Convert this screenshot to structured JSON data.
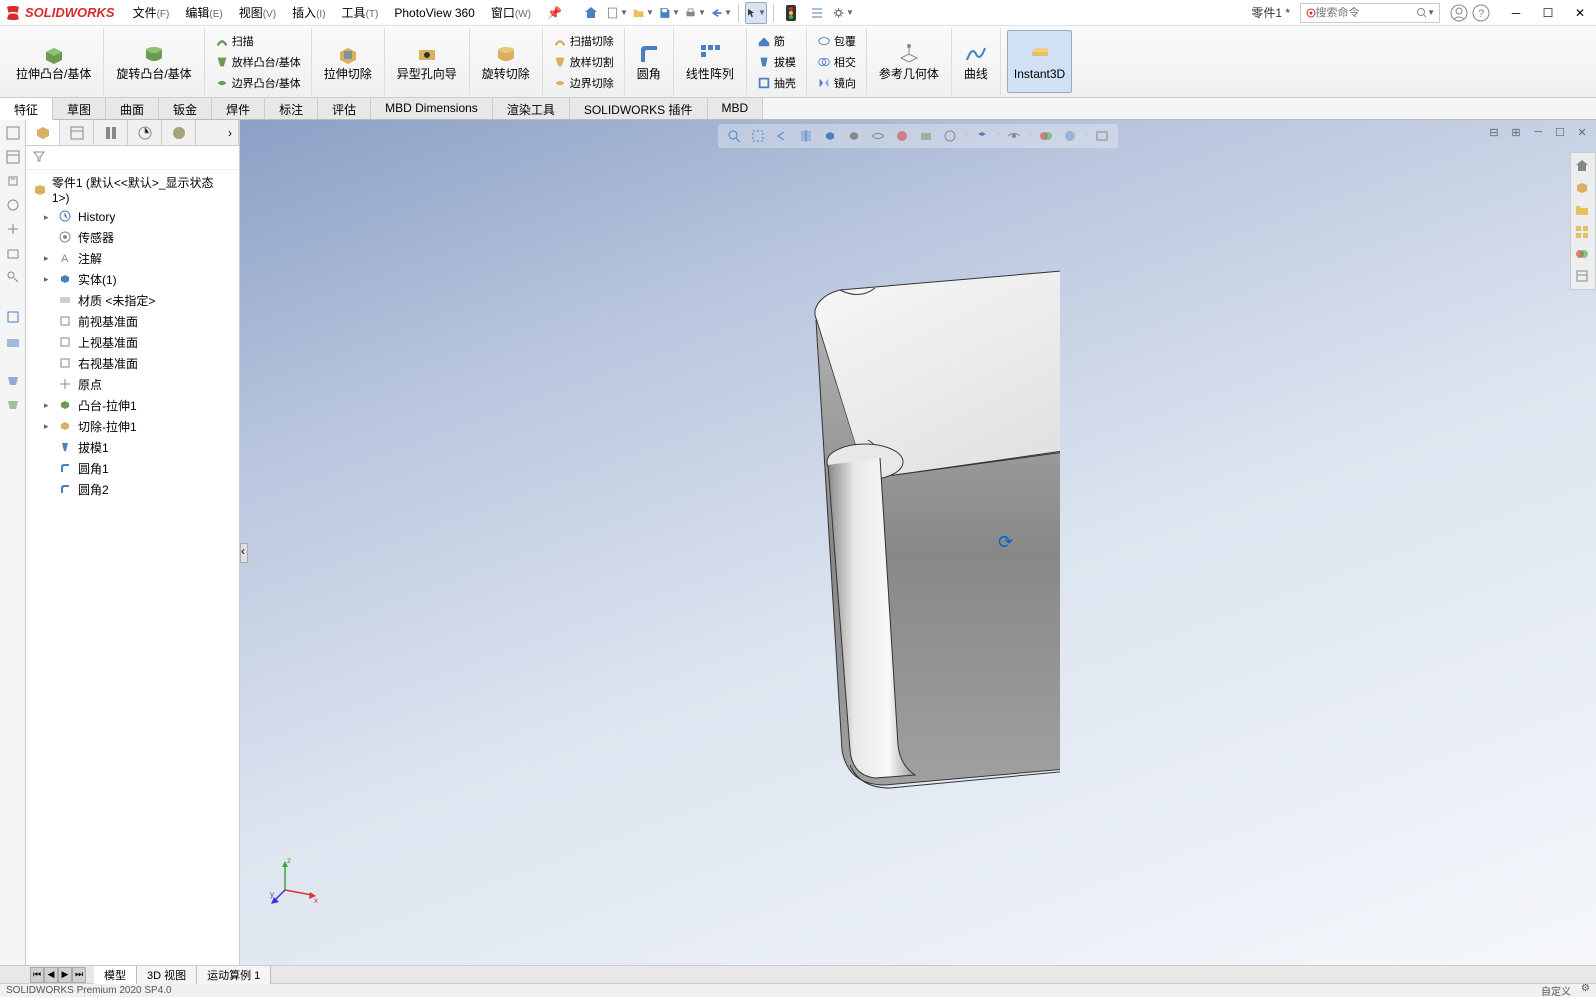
{
  "app": {
    "logo_text": "SOLIDWORKS",
    "doc_name": "零件1 *",
    "search_placeholder": "搜索命令",
    "version": "SOLIDWORKS Premium 2020 SP4.0"
  },
  "menu": {
    "file": "文件",
    "file_key": "(F)",
    "edit": "编辑",
    "edit_key": "(E)",
    "view": "视图",
    "view_key": "(V)",
    "insert": "插入",
    "insert_key": "(I)",
    "tools": "工具",
    "tools_key": "(T)",
    "photoview": "PhotoView 360",
    "window": "窗口",
    "window_key": "(W)"
  },
  "ribbon": {
    "extrude_boss": "拉伸凸台/基体",
    "revolve_boss": "旋转凸台/基体",
    "sweep": "扫描",
    "loft_boss": "放样凸台/基体",
    "boundary_boss": "边界凸台/基体",
    "extrude_cut": "拉伸切除",
    "hole_wizard": "异型孔向导",
    "revolve_cut": "旋转切除",
    "sweep_cut": "扫描切除",
    "loft_cut": "放样切割",
    "boundary_cut": "边界切除",
    "fillet": "圆角",
    "linear_pattern": "线性阵列",
    "rib": "筋",
    "draft": "拔模",
    "shell": "抽壳",
    "wrap": "包覆",
    "intersect": "相交",
    "mirror": "镜向",
    "ref_geom": "参考几何体",
    "curves": "曲线",
    "instant3d": "Instant3D"
  },
  "tabs": {
    "feature": "特征",
    "sketch": "草图",
    "surface": "曲面",
    "sheet_metal": "钣金",
    "weldments": "焊件",
    "annotate": "标注",
    "evaluate": "评估",
    "mbd_dim": "MBD Dimensions",
    "render": "渲染工具",
    "sw_plugins": "SOLIDWORKS 插件",
    "mbd": "MBD"
  },
  "tree": {
    "root": "零件1  (默认<<默认>_显示状态 1>)",
    "history": "History",
    "sensors": "传感器",
    "annotations": "注解",
    "solids": "实体(1)",
    "material": "材质 <未指定>",
    "front_plane": "前视基准面",
    "top_plane": "上视基准面",
    "right_plane": "右视基准面",
    "origin": "原点",
    "boss_extrude": "凸台-拉伸1",
    "cut_extrude": "切除-拉伸1",
    "draft1": "拔模1",
    "fillet1": "圆角1",
    "fillet2": "圆角2"
  },
  "bottom_tabs": {
    "model": "模型",
    "view3d": "3D 视图",
    "motion1": "运动算例 1"
  },
  "status": {
    "custom": "自定义"
  },
  "triad": {
    "x": "x",
    "y": "y",
    "z": "z"
  }
}
